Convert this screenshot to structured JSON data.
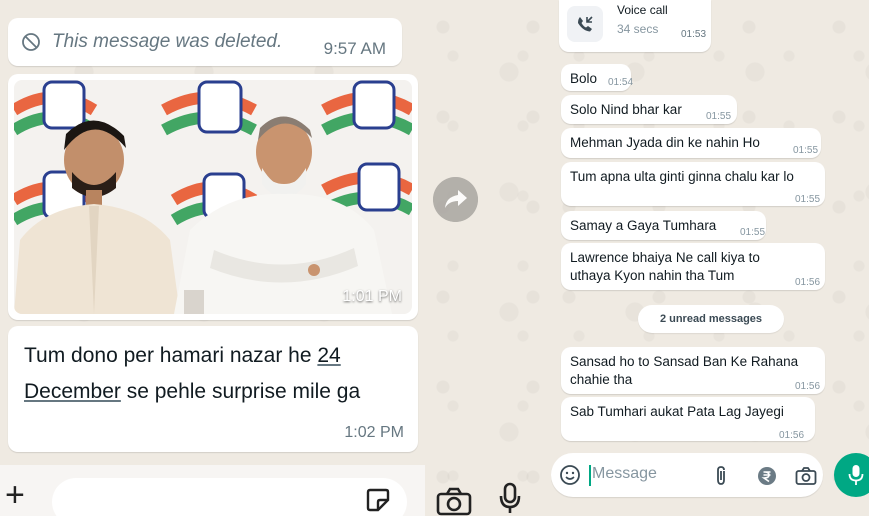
{
  "left_chat": {
    "deleted_message": {
      "text": "This message was deleted.",
      "time": "9:57 AM"
    },
    "photo_message": {
      "time": "1:01 PM"
    },
    "text_message": {
      "text_before_link": "Tum dono per hamari nazar he ",
      "link_text": "24 December",
      "text_after_link": " se pehle surprise mile ga",
      "time": "1:02 PM"
    },
    "input_bar": {
      "plus_label": "+"
    }
  },
  "right_chat": {
    "call": {
      "title": "Voice call",
      "duration": "34 secs",
      "time": "01:53"
    },
    "messages": [
      {
        "text": "Bolo",
        "time": "01:54"
      },
      {
        "text": "Solo Nind bhar kar",
        "time": "01:55"
      },
      {
        "text": "Mehman Jyada din ke nahin Ho",
        "time": "01:55"
      },
      {
        "text": "Tum apna ulta ginti ginna chalu kar lo",
        "time": "01:55"
      },
      {
        "text": "Samay a Gaya Tumhara",
        "time": "01:55"
      },
      {
        "text": "Lawrence bhaiya Ne call kiya to uthaya Kyon nahin tha Tum",
        "time": "01:56"
      },
      {
        "text": "Sansad ho to Sansad Ban Ke Rahana chahie tha",
        "time": "01:56"
      },
      {
        "text": "Sab Tumhari aukat Pata Lag Jayegi",
        "time": "01:56"
      }
    ],
    "unread_divider": "2 unread messages",
    "input": {
      "placeholder": "Message"
    }
  },
  "colors": {
    "chat_background": "#efeae2",
    "bubble": "#ffffff",
    "accent_green": "#00a884",
    "timestamp": "#667781"
  },
  "icons": [
    "ban-icon",
    "forward-icon",
    "plus-icon",
    "sticker-icon",
    "camera-icon",
    "mic-icon",
    "phone-incoming-icon",
    "emoji-icon",
    "paperclip-icon",
    "rupee-icon"
  ]
}
